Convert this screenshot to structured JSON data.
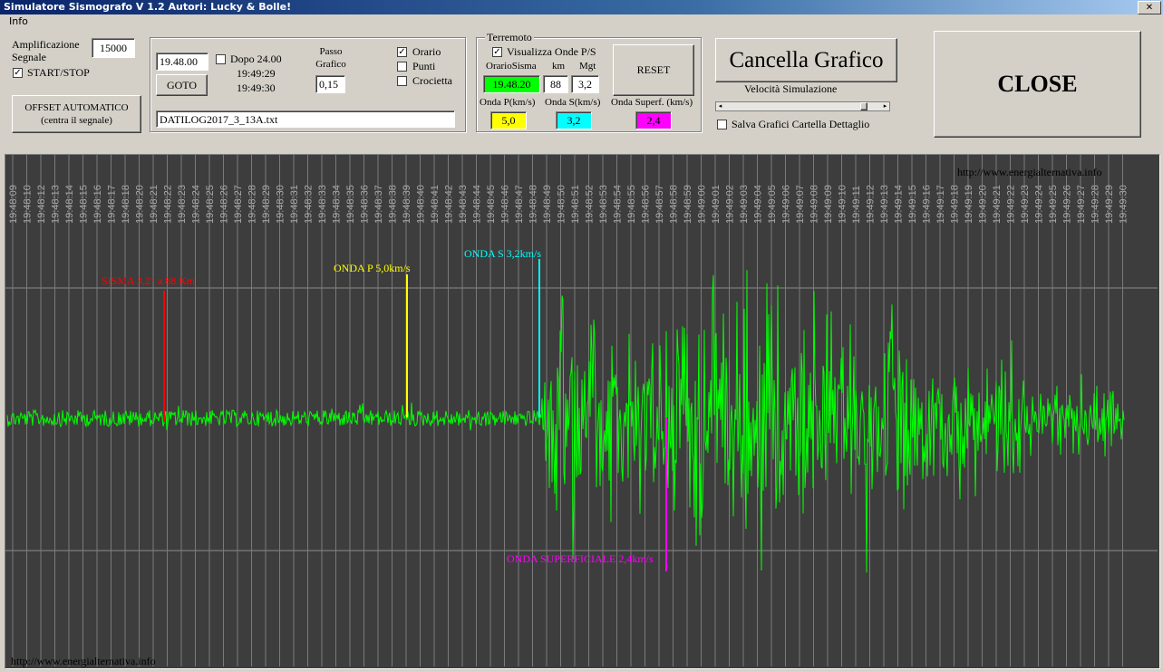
{
  "window": {
    "title": "Simulatore Sismografo V 1.2  Autori: Lucky & Bolle!",
    "close_glyph": "✕"
  },
  "menu": {
    "info": "Info"
  },
  "left": {
    "amp_label_1": "Amplificazione",
    "amp_label_2": "Segnale",
    "amp_value": "15000",
    "start_stop": "START/STOP",
    "start_stop_checked": true,
    "offset_btn_1": "OFFSET AUTOMATICO",
    "offset_btn_2": "(centra il segnale)"
  },
  "goto_panel": {
    "time_value": "19.48.00",
    "goto": "GOTO",
    "dopo_label": "Dopo 24.00",
    "time1": "19:49:29",
    "time2": "19:49:30",
    "passo_1": "Passo",
    "passo_2": "Grafico",
    "passo_value": "0,15",
    "orario": "Orario",
    "punti": "Punti",
    "crocietta": "Crocietta",
    "file": "DATILOG2017_3_13A.txt"
  },
  "terremoto": {
    "legend": "Terremoto",
    "visualizza": "Visualizza Onde P/S",
    "h_orario": "OrarioSisma",
    "h_km": "km",
    "h_mgt": "Mgt",
    "orario": "19.48.20",
    "km": "88",
    "mgt": "3,2",
    "reset": "RESET",
    "onda_p_label": "Onda P(km/s)",
    "onda_s_label": "Onda S(km/s)",
    "onda_sup_label": "Onda Superf. (km/s)",
    "onda_p": "5,0",
    "onda_s": "3,2",
    "onda_sup": "2,4"
  },
  "right": {
    "cancella": "Cancella Grafico",
    "velocita": "Velocità Simulazione",
    "velocita_level": 0.9,
    "salva": "Salva Grafici Cartella Dettaglio",
    "close": "CLOSE"
  },
  "colors": {
    "green": "#00ff00",
    "yellow": "#ffff00",
    "cyan": "#00ffff",
    "magenta": "#ff00ff",
    "red": "#ff0000",
    "plot_bg": "#3d3d3d"
  },
  "plot": {
    "website_top": "http://www.energialternativa.info",
    "website_bottom": "http://www.energialternativa.info",
    "time_labels": [
      "19:48:09",
      "19:48:10",
      "19:48:12",
      "19:48:13",
      "19:48:14",
      "19:48:15",
      "19:48:16",
      "19:48:17",
      "19:48:18",
      "19:48:20",
      "19:48:21",
      "19:48:22",
      "19:48:23",
      "19:48:24",
      "19:48:25",
      "19:48:26",
      "19:48:27",
      "19:48:28",
      "19:48:29",
      "19:48:30",
      "19:48:31",
      "19:48:32",
      "19:48:33",
      "19:48:34",
      "19:48:35",
      "19:48:36",
      "19:48:37",
      "19:48:38",
      "19:48:39",
      "19:48:40",
      "19:48:41",
      "19:48:42",
      "19:48:43",
      "19:48:44",
      "19:48:45",
      "19:48:46",
      "19:48:47",
      "19:48:48",
      "19:48:49",
      "19:48:50",
      "19:48:51",
      "19:48:52",
      "19:48:53",
      "19:48:54",
      "19:48:55",
      "19:48:56",
      "19:48:57",
      "19:48:58",
      "19:48:59",
      "19:49:00",
      "19:49:01",
      "19:49:02",
      "19:49:03",
      "19:49:04",
      "19:49:05",
      "19:49:06",
      "19:49:07",
      "19:49:08",
      "19:49:09",
      "19:49:10",
      "19:49:11",
      "19:49:12",
      "19:49:13",
      "19:49:14",
      "19:49:15",
      "19:49:16",
      "19:49:17",
      "19:49:18",
      "19:49:19",
      "19:49:20",
      "19:49:21",
      "19:49:22",
      "19:49:23",
      "19:49:24",
      "19:49:25",
      "19:49:26",
      "19:49:27",
      "19:49:28",
      "19:49:29",
      "19:49:30"
    ],
    "markers": [
      {
        "label": "SISMA 3,2° a 88 Km",
        "color": "#ff0000"
      },
      {
        "label": "ONDA P 5,0km/s",
        "color": "#ffff00"
      },
      {
        "label": "ONDA S 3,2km/s",
        "color": "#00ffff"
      },
      {
        "label": "ONDA SUPERFICIALE 2,4km/s",
        "color": "#ff00ff"
      }
    ]
  }
}
